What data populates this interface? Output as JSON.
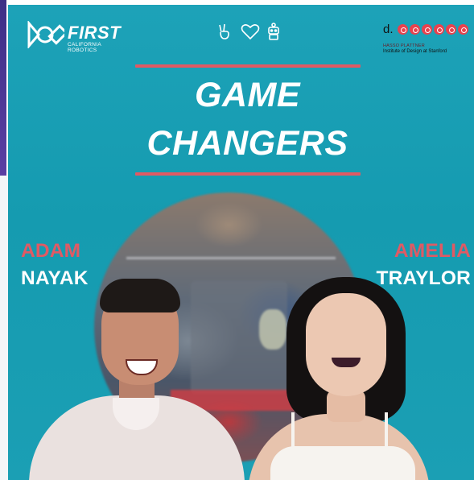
{
  "header": {
    "org_logo_text": "FIRST",
    "org_logo_subtext": "CALIFORNIA ROBOTICS",
    "icons": [
      "peace-hand-icon",
      "heart-icon",
      "robot-icon"
    ],
    "partner_logo_letter": "d.",
    "partner_logo_line1": "HASSO PLATTNER",
    "partner_logo_line2": "Institute of Design at Stanford"
  },
  "title": {
    "line1": "GAME",
    "line2": "CHANGERS"
  },
  "guests": [
    {
      "first": "ADAM",
      "last": "NAYAK"
    },
    {
      "first": "AMELIA",
      "last": "TRAYLOR"
    }
  ],
  "colors": {
    "background": "#1a9fb4",
    "accent_red": "#e05a64",
    "text_white": "#ffffff"
  }
}
